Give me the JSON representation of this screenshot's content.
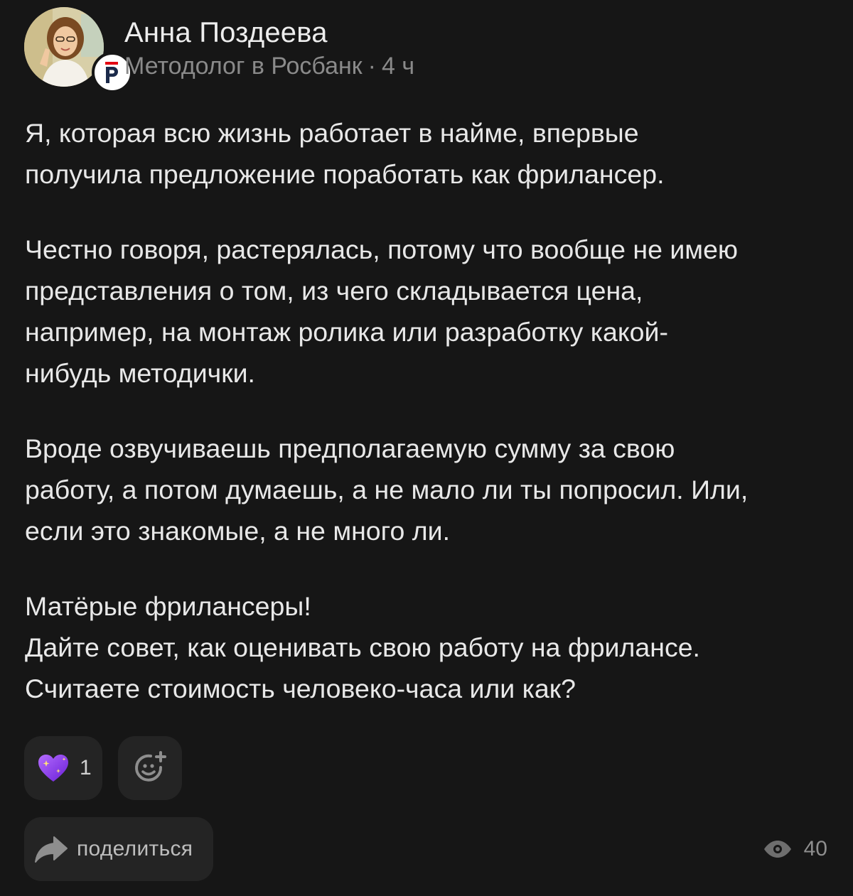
{
  "author": {
    "name": "Анна Поздеева",
    "role": "Методолог в Росбанк",
    "separator": "·",
    "time": "4 ч",
    "avatar_icon": "user-photo",
    "org_badge_letter": "Р",
    "org_badge_color": "#e30613"
  },
  "post": {
    "paragraphs": [
      "Я, которая всю жизнь работает в найме, впервые\nполучила предложение поработать как фрилансер.",
      "Честно говоря, растерялась, потому что вообще не имею\nпредставления о том, из чего складывается цена,\nнапример, на монтаж ролика или разработку какой-\nнибудь методички.",
      "Вроде озвучиваешь предполагаемую сумму за свою\nработу, а потом думаешь, а не мало ли ты попросил. Или,\nесли это знакомые, а не много ли.",
      "Матёрые фрилансеры!\nДайте совет, как оценивать свою работу на фрилансе.\nСчитаете стоимость человеко-часа или как?"
    ]
  },
  "reactions": {
    "heart": {
      "icon": "sparkling-purple-heart-icon",
      "count": "1",
      "color": "#8b3cf0"
    },
    "add_icon": "add-reaction-smile-icon"
  },
  "actions": {
    "share_label": "поделиться",
    "share_icon": "share-arrow-icon"
  },
  "stats": {
    "views_icon": "eye-icon",
    "views": "40"
  },
  "colors": {
    "background": "#161616",
    "chip": "#242424",
    "text": "#e8e8e8",
    "muted": "#8a8a8a"
  }
}
